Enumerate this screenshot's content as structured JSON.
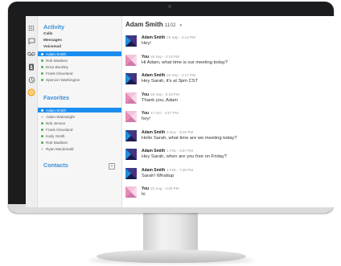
{
  "rail_icons": [
    "grid-icon",
    "chat-bubble-icon",
    "voicemail-icon",
    "contacts-book-icon",
    "history-icon",
    "settings-icon"
  ],
  "sidebar": {
    "activity_title": "Activity",
    "activity_items": [
      "Calls",
      "Messages",
      "Voicemail"
    ],
    "activity_contacts": [
      {
        "name": "Adam Smith",
        "selected": true,
        "online": true
      },
      {
        "name": "Rob Madison",
        "selected": false,
        "online": true
      },
      {
        "name": "Erica Buckley",
        "selected": false,
        "online": true
      },
      {
        "name": "Frank Cleveland",
        "selected": false,
        "online": true
      },
      {
        "name": "Spencer Washington",
        "selected": false,
        "online": true
      }
    ],
    "favorites_title": "Favorites",
    "favorites": [
      {
        "name": "Adam Smith",
        "selected": true,
        "online": true
      },
      {
        "name": "Adam Wainwright",
        "selected": false,
        "online": false
      },
      {
        "name": "Bob Jenson",
        "selected": false,
        "online": true
      },
      {
        "name": "Frank Cleveland",
        "selected": false,
        "online": true
      },
      {
        "name": "Karly Smith",
        "selected": false,
        "online": true
      },
      {
        "name": "Rob Madison",
        "selected": false,
        "online": true
      },
      {
        "name": "Ryan Macdonald",
        "selected": false,
        "online": false
      }
    ],
    "contacts_title": "Contacts"
  },
  "chat": {
    "header_name": "Adam Smith",
    "header_ext": "1102",
    "messages": [
      {
        "author": "Adam Smith",
        "time": "25 Sep - 2:14 PM",
        "text": "Hey!",
        "avatar": "adam"
      },
      {
        "author": "You",
        "time": "25 Sep - 2:16 PM",
        "text": "Hi Adam, what time is our meeting today?",
        "avatar": "you"
      },
      {
        "author": "Adam Smith",
        "time": "25 Sep - 2:17 PM",
        "text": "Hey Sarah, it's at 3pm CST",
        "avatar": "adam"
      },
      {
        "author": "You",
        "time": "25 Sep - 2:18 PM",
        "text": "Thank you, Adam",
        "avatar": "you"
      },
      {
        "author": "You",
        "time": "17 Oct - 4:57 PM",
        "text": "hey!",
        "avatar": "you"
      },
      {
        "author": "Adam Smith",
        "time": "6 Nov - 8:20 PM",
        "text": "Hello Sarah, what time are we meeting today?",
        "avatar": "adam"
      },
      {
        "author": "Adam Smith",
        "time": "1 Feb - 3:57 PM",
        "text": "Hey Sarah, when are you free on Friday?",
        "avatar": "adam"
      },
      {
        "author": "Adam Smith",
        "time": "1 Feb - 7:25 PM",
        "text": "Sarah! Whattup",
        "avatar": "adam"
      },
      {
        "author": "You",
        "time": "21 Aug - 4:49 PM",
        "text": "hi",
        "avatar": "you"
      }
    ]
  },
  "colors": {
    "accent": "#3d8fd6",
    "selected": "#1a8ef0",
    "online": "#4caf50"
  }
}
